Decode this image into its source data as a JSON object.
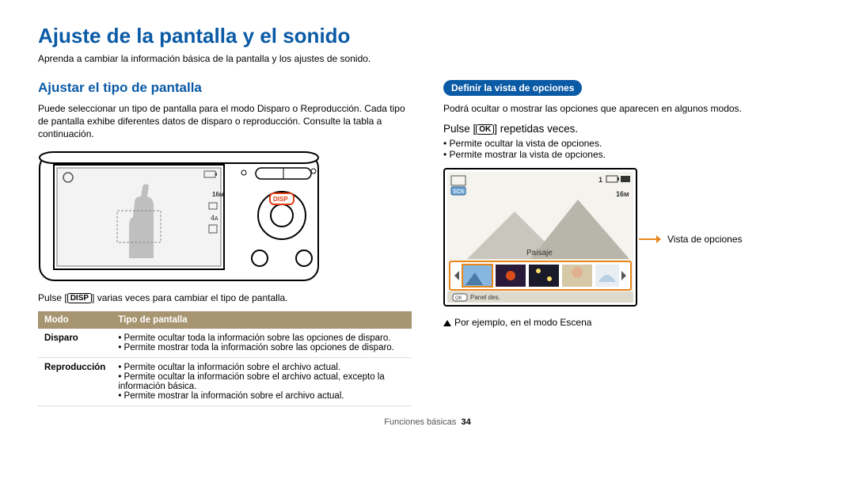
{
  "title": "Ajuste de la pantalla y el sonido",
  "lede": "Aprenda a cambiar la información básica de la pantalla y los ajustes de sonido.",
  "left": {
    "heading": "Ajustar el tipo de pantalla",
    "para": "Puede seleccionar un tipo de pantalla para el modo Disparo o Reproducción. Cada tipo de pantalla exhibe diferentes datos de disparo o reproducción. Consulte la tabla a continuación.",
    "disp_label": "DISP",
    "caption_before": "Pulse [",
    "caption_after": "] varias veces para cambiar el tipo de pantalla.",
    "table": {
      "head_mode": "Modo",
      "head_type": "Tipo de pantalla",
      "row1_mode": "Disparo",
      "row1_items": [
        "Permite ocultar toda la información sobre las opciones de disparo.",
        "Permite mostrar toda la información sobre las opciones de disparo."
      ],
      "row2_mode": "Reproducción",
      "row2_items": [
        "Permite ocultar la información sobre el archivo actual.",
        "Permite ocultar la información sobre el archivo actual, excepto la información básica.",
        "Permite mostrar la información sobre el archivo actual."
      ]
    }
  },
  "right": {
    "pill": "Definir la vista de opciones",
    "para": "Podrá ocultar o mostrar las opciones que aparecen en algunos modos.",
    "instr_before": "Pulse [",
    "ok_label": "OK",
    "instr_after": "] repetidas veces.",
    "bullets": [
      "Permite ocultar la vista de opciones.",
      "Permite mostrar la vista de opciones."
    ],
    "screen": {
      "scn": "SCN",
      "sixteen": "16M",
      "paisaje": "Paisaje",
      "panel": "Panel des.",
      "ok_small": "OK"
    },
    "annotation": "Vista de opciones",
    "example": "Por ejemplo, en el modo Escena"
  },
  "footer": {
    "section": "Funciones básicas",
    "page": "34"
  }
}
